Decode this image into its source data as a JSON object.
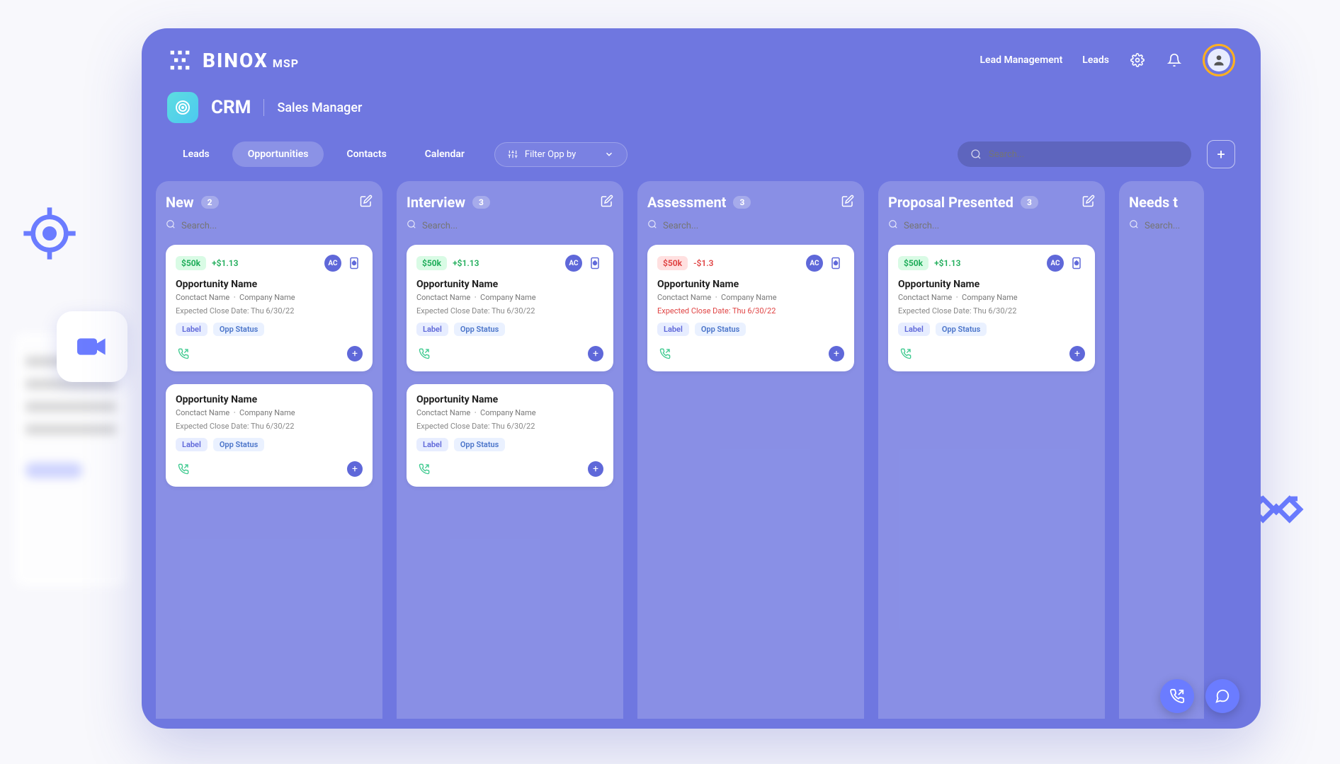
{
  "brand": {
    "name": "BINOX",
    "suffix": "MSP"
  },
  "header": {
    "links": [
      "Lead Management",
      "Leads"
    ]
  },
  "page_title": {
    "app": "CRM",
    "section": "Sales Manager"
  },
  "tabs": {
    "items": [
      "Leads",
      "Opportunities",
      "Contacts",
      "Calendar"
    ],
    "active_index": 1
  },
  "filter": {
    "label": "Filter Opp by"
  },
  "global_search": {
    "placeholder": "Search..."
  },
  "columns": [
    {
      "title": "New",
      "count": "2",
      "search_placeholder": "Search...",
      "cards": [
        {
          "amount": "$50k",
          "amount_style": "green",
          "delta": "+$1.13",
          "delta_style": "pos",
          "ac": "AC",
          "title": "Opportunity Name",
          "contact": "Conctact Name",
          "company": "Company Name",
          "date_label": "Expected Close Date:",
          "date_value": "Thu 6/30/22",
          "overdue": false,
          "label_chip": "Label",
          "status_chip": "Opp Status"
        },
        {
          "simple": true,
          "title": "Opportunity Name",
          "contact": "Conctact Name",
          "company": "Company Name",
          "date_label": "Expected Close Date:",
          "date_value": "Thu 6/30/22",
          "overdue": false,
          "label_chip": "Label",
          "status_chip": "Opp Status"
        }
      ]
    },
    {
      "title": "Interview",
      "count": "3",
      "search_placeholder": "Search...",
      "cards": [
        {
          "amount": "$50k",
          "amount_style": "green",
          "delta": "+$1.13",
          "delta_style": "pos",
          "ac": "AC",
          "title": "Opportunity Name",
          "contact": "Conctact Name",
          "company": "Company Name",
          "date_label": "Expected Close Date:",
          "date_value": "Thu 6/30/22",
          "overdue": false,
          "label_chip": "Label",
          "status_chip": "Opp Status"
        },
        {
          "simple": true,
          "title": "Opportunity Name",
          "contact": "Conctact Name",
          "company": "Company Name",
          "date_label": "Expected Close Date:",
          "date_value": "Thu 6/30/22",
          "overdue": false,
          "label_chip": "Label",
          "status_chip": "Opp Status"
        }
      ]
    },
    {
      "title": "Assessment",
      "count": "3",
      "search_placeholder": "Search...",
      "cards": [
        {
          "amount": "$50k",
          "amount_style": "red",
          "delta": "-$1.3",
          "delta_style": "neg",
          "ac": "AC",
          "title": "Opportunity Name",
          "contact": "Conctact Name",
          "company": "Company Name",
          "date_label": "Expected Close Date:",
          "date_value": "Thu 6/30/22",
          "overdue": true,
          "label_chip": "Label",
          "status_chip": "Opp Status"
        }
      ]
    },
    {
      "title": "Proposal Presented",
      "count": "3",
      "search_placeholder": "Search...",
      "cards": [
        {
          "amount": "$50k",
          "amount_style": "green",
          "delta": "+$1.13",
          "delta_style": "pos",
          "ac": "AC",
          "title": "Opportunity Name",
          "contact": "Conctact Name",
          "company": "Company Name",
          "date_label": "Expected Close Date:",
          "date_value": "Thu 6/30/22",
          "overdue": false,
          "label_chip": "Label",
          "status_chip": "Opp Status"
        }
      ]
    },
    {
      "title": "Needs t",
      "count": "",
      "search_placeholder": "Search...",
      "partial": true,
      "cards": []
    }
  ]
}
